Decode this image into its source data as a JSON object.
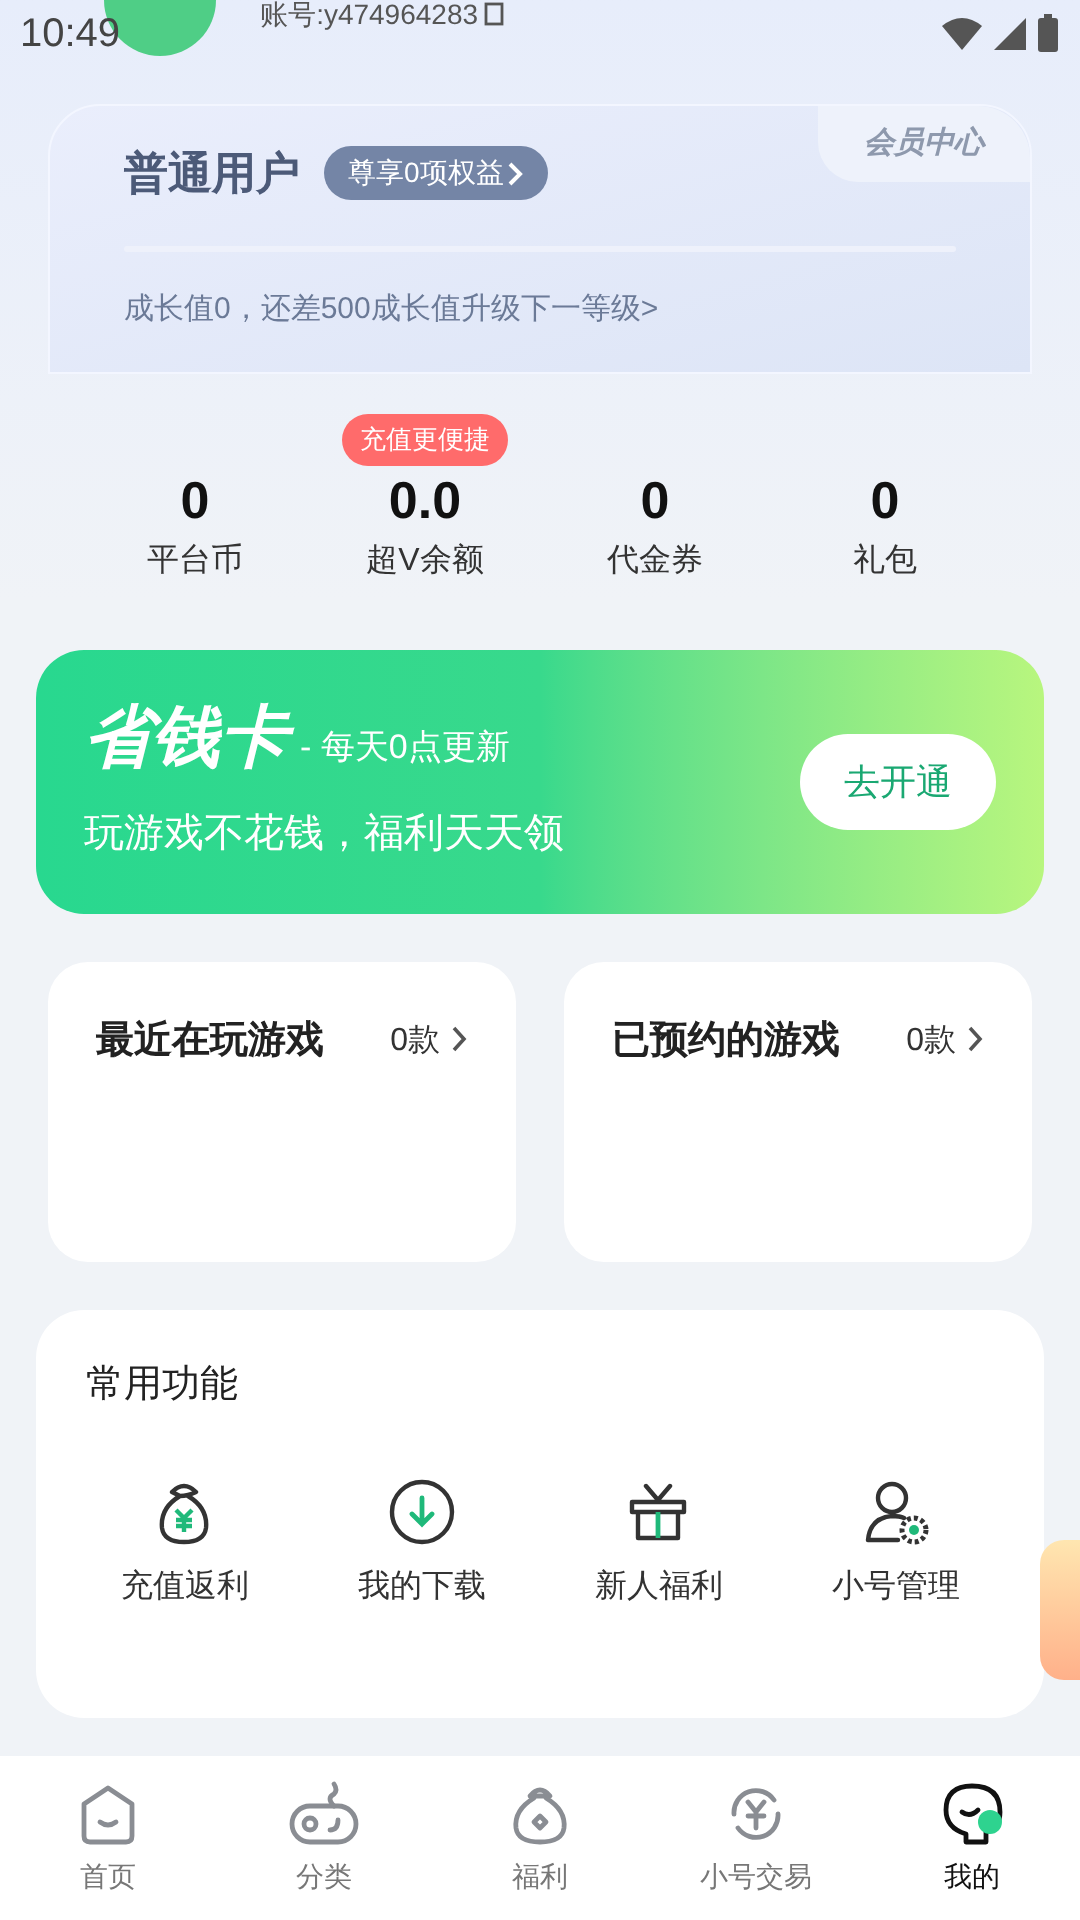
{
  "status_bar": {
    "time": "10:49"
  },
  "account": {
    "text": "账号:y474964283"
  },
  "member_card": {
    "level": "普通用户",
    "benefits": "尊享0项权益",
    "center": "会员中心",
    "progress_text": "成长值0，还差500成长值升级下一等级>"
  },
  "stats": [
    {
      "value": "0",
      "label": "平台币"
    },
    {
      "value": "0.0",
      "label": "超V余额",
      "badge": "充值更便捷"
    },
    {
      "value": "0",
      "label": "代金券"
    },
    {
      "value": "0",
      "label": "礼包"
    }
  ],
  "saving_card": {
    "title": "省钱卡",
    "subtitle": "- 每天0点更新",
    "slogan": "玩游戏不花钱，福利天天领",
    "button": "去开通"
  },
  "game_cards": [
    {
      "title": "最近在玩游戏",
      "count": "0款"
    },
    {
      "title": "已预约的游戏",
      "count": "0款"
    }
  ],
  "functions": {
    "title": "常用功能",
    "items": [
      {
        "kind": "moneybag",
        "label": "充值返利"
      },
      {
        "kind": "download",
        "label": "我的下载"
      },
      {
        "kind": "gift",
        "label": "新人福利"
      },
      {
        "kind": "usergear",
        "label": "小号管理"
      }
    ]
  },
  "tab_bar": [
    {
      "kind": "home",
      "label": "首页",
      "selected": false
    },
    {
      "kind": "gamepad",
      "label": "分类",
      "selected": false
    },
    {
      "kind": "bag",
      "label": "福利",
      "selected": false
    },
    {
      "kind": "exchange",
      "label": "小号交易",
      "selected": false
    },
    {
      "kind": "me",
      "label": "我的",
      "selected": true
    }
  ]
}
